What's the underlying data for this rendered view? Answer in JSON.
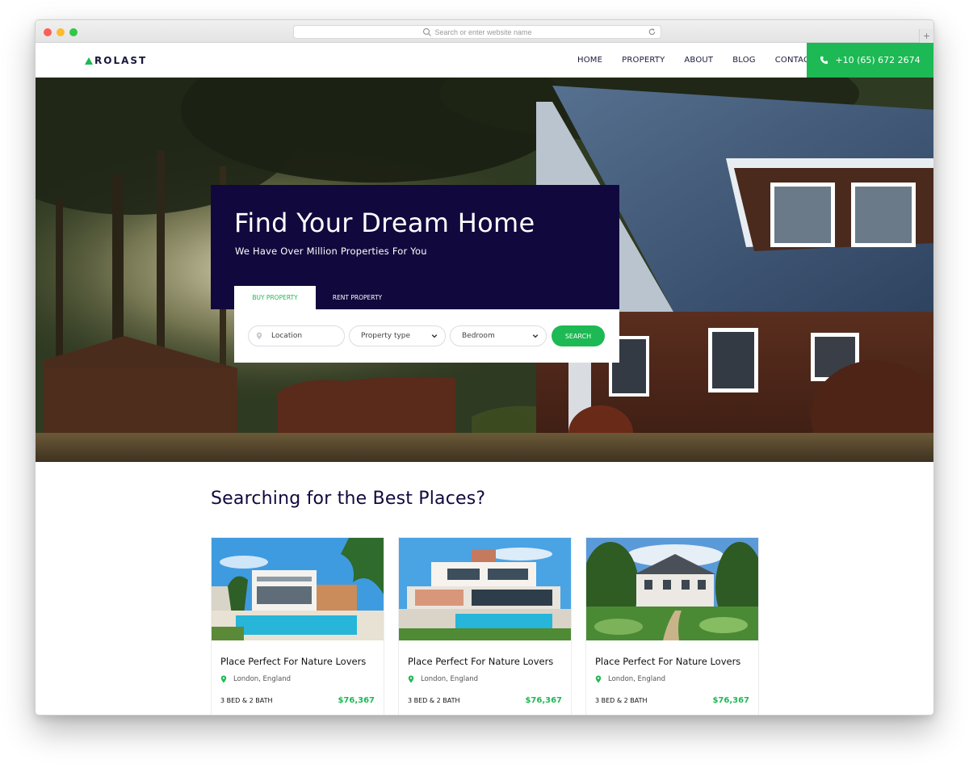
{
  "browser": {
    "url_placeholder": "Search or enter website name",
    "new_tab_label": "+"
  },
  "nav": {
    "logo_text": "ROLAST",
    "menu": [
      "HOME",
      "PROPERTY",
      "ABOUT",
      "BLOG",
      "CONTACT"
    ],
    "phone": "+10 (65) 672 2674"
  },
  "hero": {
    "title": "Find Your Dream Home",
    "subtitle": "We Have Over Million Properties For You",
    "tabs": [
      "BUY PROPERTY",
      "RENT PROPERTY"
    ],
    "active_tab": "BUY PROPERTY",
    "location_placeholder": "Location",
    "property_type": "Property type",
    "bedroom": "Bedroom",
    "search_label": "SEARCH"
  },
  "listings": {
    "section_title": "Searching for the Best Places?",
    "cards": [
      {
        "title": "Place Perfect For Nature Lovers",
        "location": "London, England",
        "specs": "3 BED & 2 BATH",
        "price": "$76,367"
      },
      {
        "title": "Place Perfect For Nature Lovers",
        "location": "London, England",
        "specs": "3 BED & 2 BATH",
        "price": "$76,367"
      },
      {
        "title": "Place Perfect For Nature Lovers",
        "location": "London, England",
        "specs": "3 BED & 2 BATH",
        "price": "$76,367"
      }
    ]
  },
  "colors": {
    "accent_green": "#1db954",
    "navy": "#11093d"
  }
}
